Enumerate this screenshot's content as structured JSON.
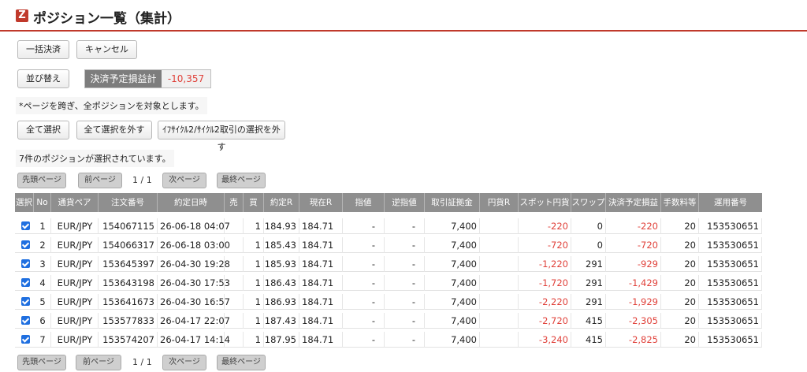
{
  "page": {
    "title": "ポジション一覧（集計）",
    "logo_letter": "Z"
  },
  "actions": {
    "bulk_settle": "一括決済",
    "cancel": "キャンセル",
    "sort": "並び替え"
  },
  "settlement": {
    "label": "決済予定損益計",
    "value": "-10,357"
  },
  "notice": "*ページを跨ぎ、全ポジションを対象とします。",
  "selection": {
    "select_all": "全て選択",
    "deselect_all": "全て選択を外す",
    "deselect_cycle": "ｲﾌｻｲｸﾙ2/ｻｲｸﾙ2取引の選択を外す",
    "status": "7件のポジションが選択されています。"
  },
  "pager": {
    "first": "先頭ページ",
    "prev": "前ページ",
    "page_text": "1 / 1",
    "next": "次ページ",
    "last": "最終ページ"
  },
  "table": {
    "headers": [
      "選択",
      "No",
      "通貨ペア",
      "注文番号",
      "約定日時",
      "売",
      "買",
      "約定R",
      "現在R",
      "指値",
      "逆指値",
      "取引証拠金",
      "円貨R",
      "スポット円貨",
      "スワップ",
      "決済予定損益",
      "手数料等",
      "運用番号"
    ],
    "rows": [
      {
        "checked": true,
        "no": "1",
        "pair": "EUR/JPY",
        "order": "154067115",
        "datetime": "26-06-18 04:07",
        "sell": "",
        "buy": "1",
        "exec_rate": "184.93",
        "current_rate": "184.71",
        "limit": "-",
        "stop": "-",
        "margin": "7,400",
        "yen_rate": "",
        "spot": "-220",
        "swap": "0",
        "pnl": "-220",
        "fee": "20",
        "op_no": "153530651"
      },
      {
        "checked": true,
        "no": "2",
        "pair": "EUR/JPY",
        "order": "154066317",
        "datetime": "26-06-18 03:00",
        "sell": "",
        "buy": "1",
        "exec_rate": "185.43",
        "current_rate": "184.71",
        "limit": "-",
        "stop": "-",
        "margin": "7,400",
        "yen_rate": "",
        "spot": "-720",
        "swap": "0",
        "pnl": "-720",
        "fee": "20",
        "op_no": "153530651"
      },
      {
        "checked": true,
        "no": "3",
        "pair": "EUR/JPY",
        "order": "153645397",
        "datetime": "26-04-30 19:28",
        "sell": "",
        "buy": "1",
        "exec_rate": "185.93",
        "current_rate": "184.71",
        "limit": "-",
        "stop": "-",
        "margin": "7,400",
        "yen_rate": "",
        "spot": "-1,220",
        "swap": "291",
        "pnl": "-929",
        "fee": "20",
        "op_no": "153530651"
      },
      {
        "checked": true,
        "no": "4",
        "pair": "EUR/JPY",
        "order": "153643198",
        "datetime": "26-04-30 17:53",
        "sell": "",
        "buy": "1",
        "exec_rate": "186.43",
        "current_rate": "184.71",
        "limit": "-",
        "stop": "-",
        "margin": "7,400",
        "yen_rate": "",
        "spot": "-1,720",
        "swap": "291",
        "pnl": "-1,429",
        "fee": "20",
        "op_no": "153530651"
      },
      {
        "checked": true,
        "no": "5",
        "pair": "EUR/JPY",
        "order": "153641673",
        "datetime": "26-04-30 16:57",
        "sell": "",
        "buy": "1",
        "exec_rate": "186.93",
        "current_rate": "184.71",
        "limit": "-",
        "stop": "-",
        "margin": "7,400",
        "yen_rate": "",
        "spot": "-2,220",
        "swap": "291",
        "pnl": "-1,929",
        "fee": "20",
        "op_no": "153530651"
      },
      {
        "checked": true,
        "no": "6",
        "pair": "EUR/JPY",
        "order": "153577833",
        "datetime": "26-04-17 22:07",
        "sell": "",
        "buy": "1",
        "exec_rate": "187.43",
        "current_rate": "184.71",
        "limit": "-",
        "stop": "-",
        "margin": "7,400",
        "yen_rate": "",
        "spot": "-2,720",
        "swap": "415",
        "pnl": "-2,305",
        "fee": "20",
        "op_no": "153530651"
      },
      {
        "checked": true,
        "no": "7",
        "pair": "EUR/JPY",
        "order": "153574207",
        "datetime": "26-04-17 14:14",
        "sell": "",
        "buy": "1",
        "exec_rate": "187.95",
        "current_rate": "184.71",
        "limit": "-",
        "stop": "-",
        "margin": "7,400",
        "yen_rate": "",
        "spot": "-3,240",
        "swap": "415",
        "pnl": "-2,825",
        "fee": "20",
        "op_no": "153530651"
      }
    ]
  },
  "colors": {
    "accent": "#c0392b",
    "negative": "#e0413a",
    "header_bg": "#8f8f8f",
    "checkbox": "#1f6fe0"
  }
}
